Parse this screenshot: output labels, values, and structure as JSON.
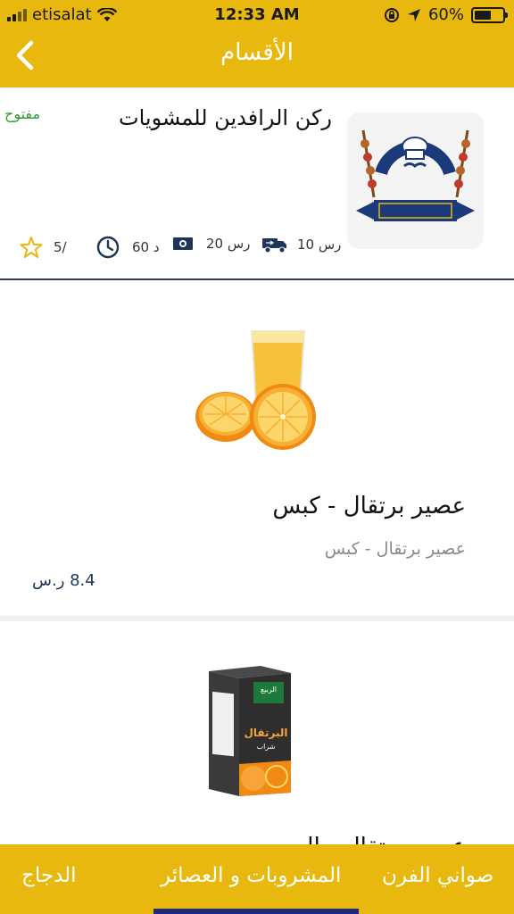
{
  "status_bar": {
    "carrier": "etisalat",
    "time": "12:33 AM",
    "battery": "60%"
  },
  "header": {
    "title": "الأقسام"
  },
  "restaurant": {
    "name": "ركن الرافدين للمشويات",
    "status": "مفتوح",
    "delivery_fee": "10 رس",
    "min_order": "20 رس",
    "delivery_time": "60 د",
    "rating": "5/",
    "logo": {
      "brand_latin": "ROKN ALRAFEDIN RESTAURANTS",
      "brand_arabic_top": "مطاعم",
      "brand_arabic": "ركن الرافدين"
    }
  },
  "products": [
    {
      "name": "عصير برتقال - كبس",
      "description": "عصير برتقال - كبس",
      "price": "8.4 ر.س"
    },
    {
      "name": "عصير برتقال - الربيع",
      "package_brand": "الربيع",
      "package_label": "البرتقال",
      "package_sub": "شراب"
    }
  ],
  "tabs": [
    {
      "label": "الدجاج"
    },
    {
      "label": "المشروبات و العصائر",
      "active": true
    },
    {
      "label": "صواني الفرن"
    }
  ],
  "colors": {
    "brand_yellow": "#e8b80f",
    "open_green": "#2e9b2e",
    "active_indicator": "#1f2a7a",
    "price_blue": "#1d3557"
  }
}
